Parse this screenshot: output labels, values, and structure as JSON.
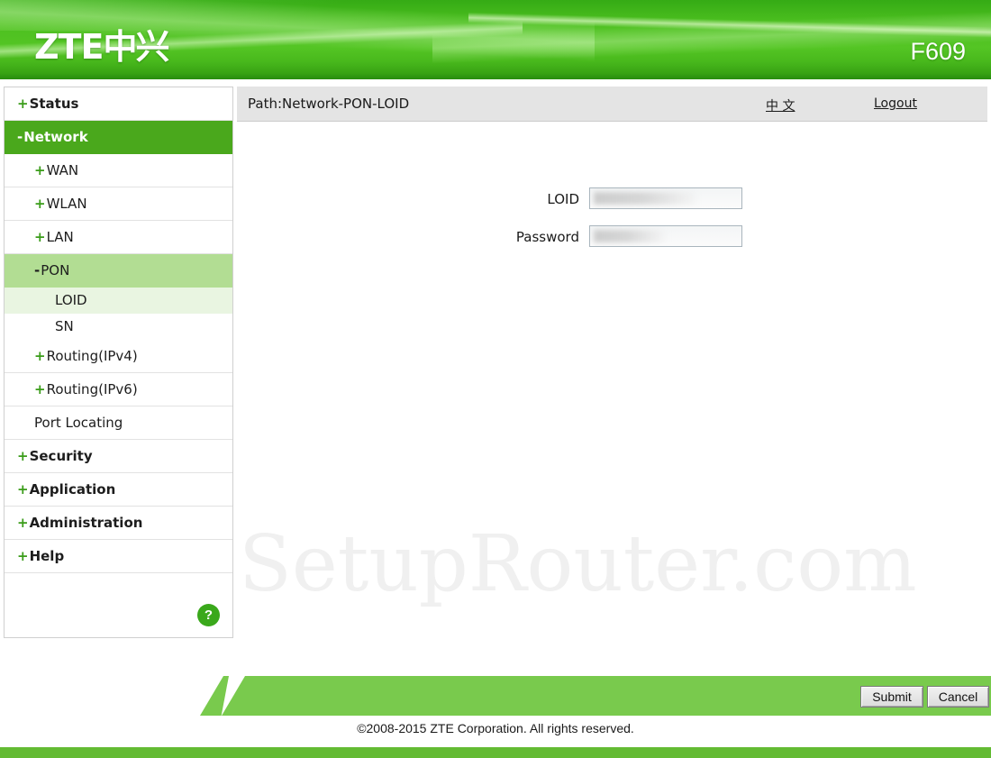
{
  "header": {
    "logo_text": "ZTE",
    "logo_cn": "中兴",
    "model": "F609"
  },
  "sidebar": {
    "items": [
      {
        "prefix": "+",
        "label": "Status",
        "level": "top",
        "state": "normal"
      },
      {
        "prefix": "-",
        "label": "Network",
        "level": "top",
        "state": "active-top"
      },
      {
        "prefix": "+",
        "label": "WAN",
        "level": "sub",
        "state": "normal"
      },
      {
        "prefix": "+",
        "label": "WLAN",
        "level": "sub",
        "state": "normal"
      },
      {
        "prefix": "+",
        "label": "LAN",
        "level": "sub",
        "state": "normal"
      },
      {
        "prefix": "-",
        "label": "PON",
        "level": "sub",
        "state": "active-mid"
      },
      {
        "prefix": "",
        "label": "LOID",
        "level": "leaf",
        "state": "active-leaf"
      },
      {
        "prefix": "",
        "label": "SN",
        "level": "leaf",
        "state": "normal"
      },
      {
        "prefix": "+",
        "label": "Routing(IPv4)",
        "level": "sub",
        "state": "normal"
      },
      {
        "prefix": "+",
        "label": "Routing(IPv6)",
        "level": "sub",
        "state": "normal"
      },
      {
        "prefix": "",
        "label": "Port Locating",
        "level": "sub",
        "state": "normal"
      },
      {
        "prefix": "+",
        "label": "Security",
        "level": "top",
        "state": "normal"
      },
      {
        "prefix": "+",
        "label": "Application",
        "level": "top",
        "state": "normal"
      },
      {
        "prefix": "+",
        "label": "Administration",
        "level": "top",
        "state": "normal"
      },
      {
        "prefix": "+",
        "label": "Help",
        "level": "top",
        "state": "normal"
      }
    ],
    "help_icon": "?"
  },
  "main": {
    "path": "Path:Network-PON-LOID",
    "lang_link": "中 文",
    "logout_link": "Logout",
    "watermark": "SetupRouter.com",
    "form": {
      "fields": [
        {
          "label": "LOID",
          "value": "",
          "redacted": true,
          "blur_width": 118
        },
        {
          "label": "Password",
          "value": "",
          "redacted": true,
          "blur_width": 82
        }
      ]
    }
  },
  "footer": {
    "submit_label": "Submit",
    "cancel_label": "Cancel",
    "copyright": "©2008-2015 ZTE Corporation. All rights reserved."
  },
  "colors": {
    "header_green": "#4cbf1f",
    "active_nav": "#4aa81c",
    "mid_nav": "#b2dd93",
    "leaf_nav": "#e9f5e1",
    "footer_green": "#79ca4d",
    "strip_green": "#63bb33"
  }
}
